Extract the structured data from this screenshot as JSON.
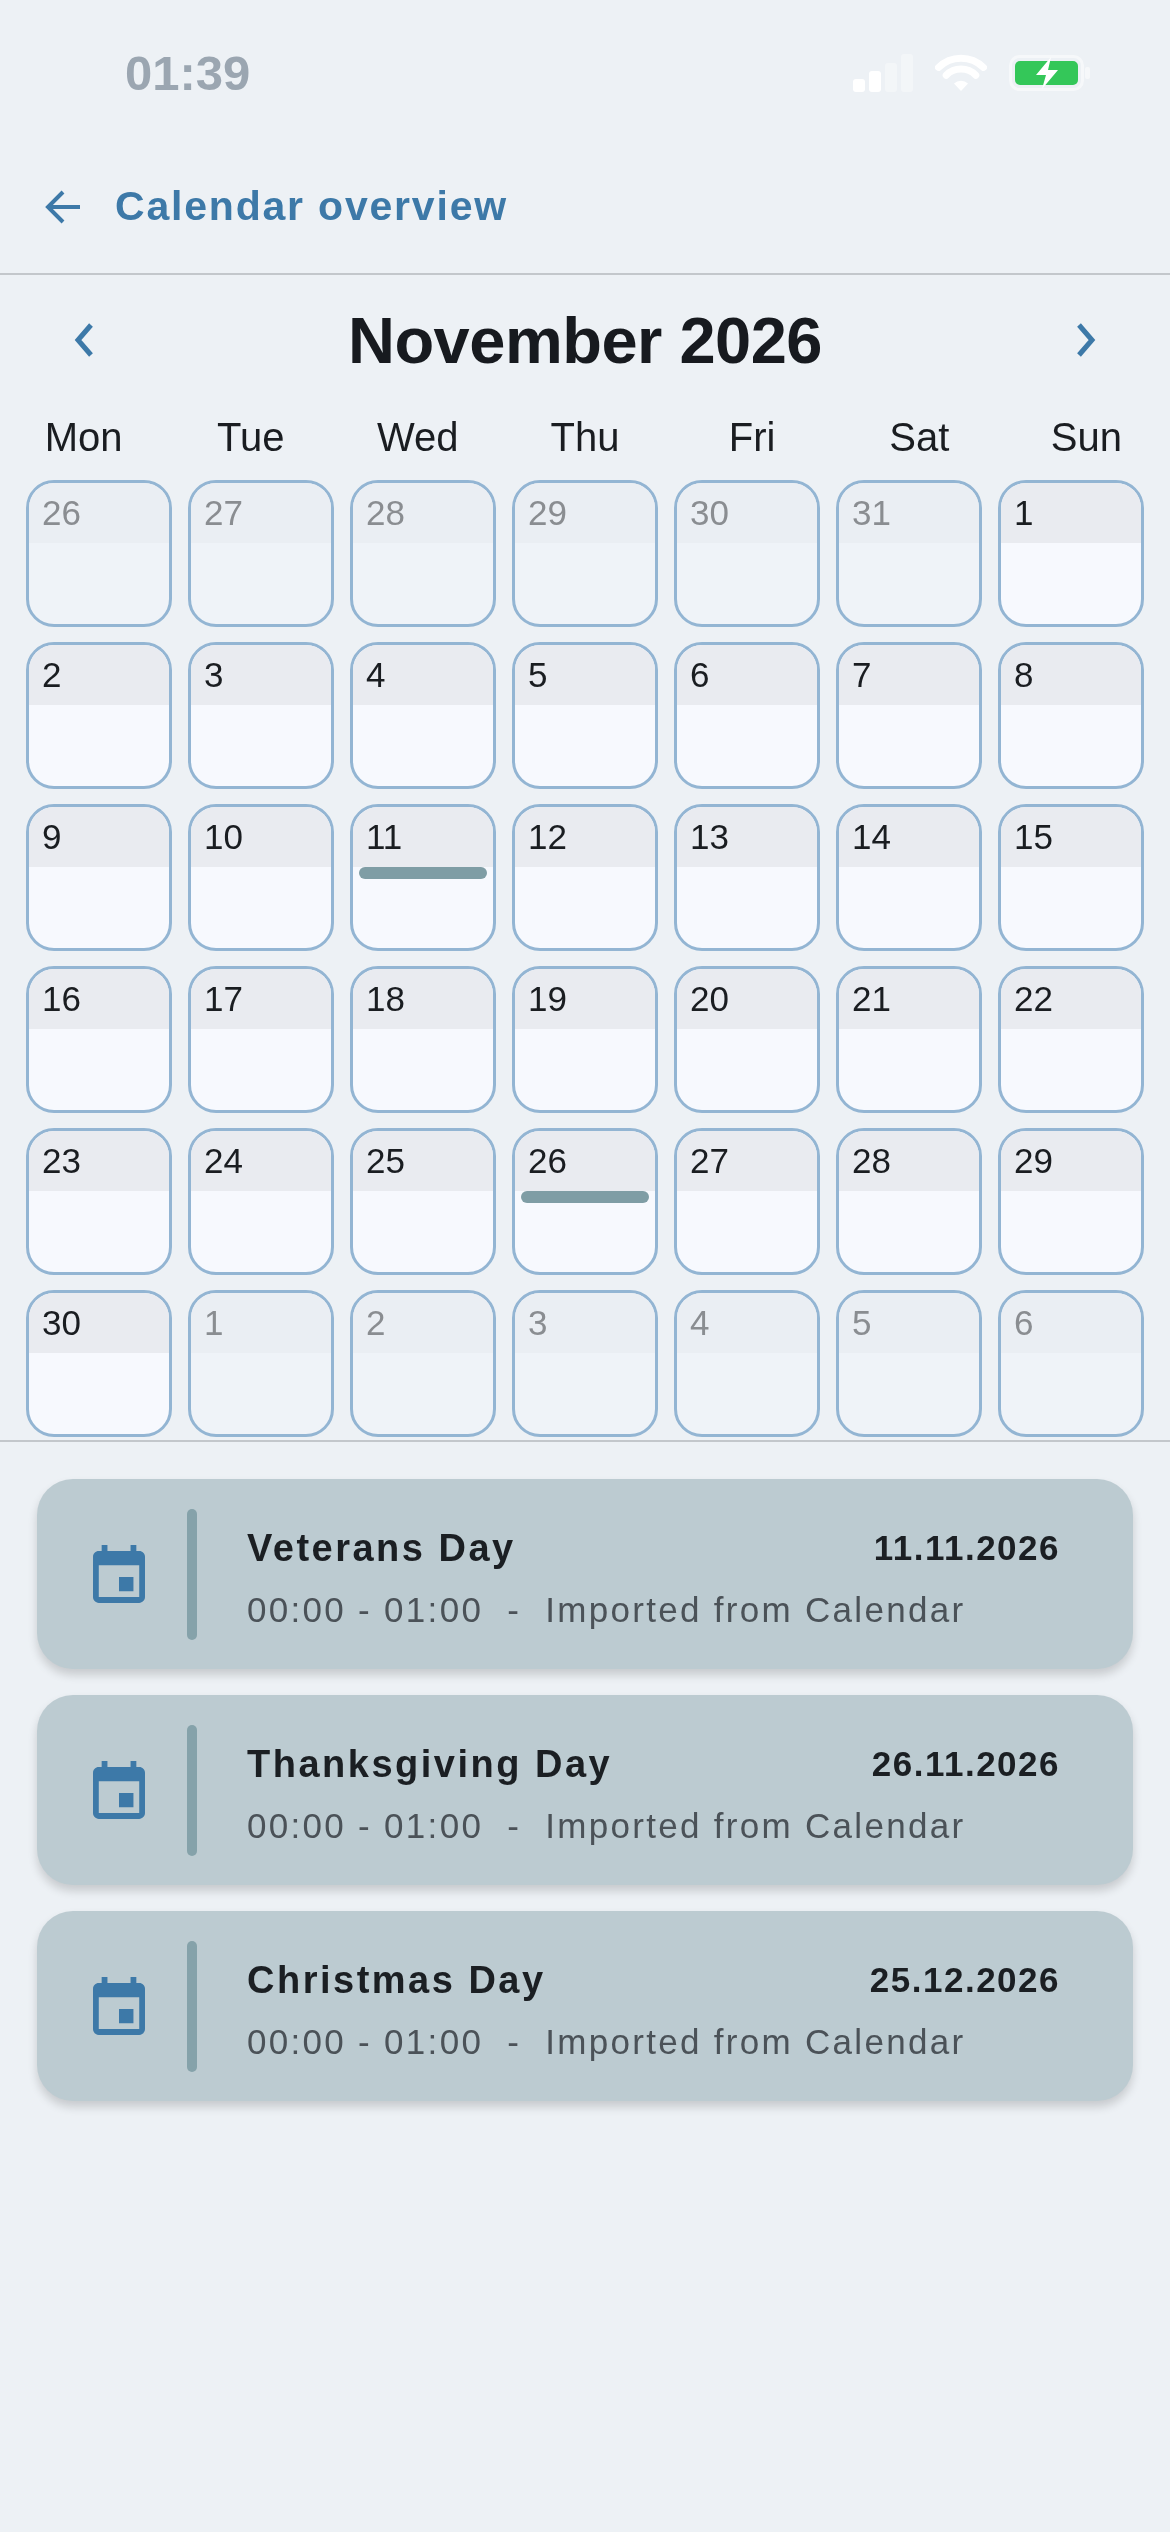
{
  "status_bar": {
    "time": "01:39"
  },
  "header": {
    "title": "Calendar overview"
  },
  "month_nav": {
    "title": "November 2026"
  },
  "weekdays": [
    "Mon",
    "Tue",
    "Wed",
    "Thu",
    "Fri",
    "Sat",
    "Sun"
  ],
  "days": [
    {
      "day": "26",
      "in_month": false,
      "event": false
    },
    {
      "day": "27",
      "in_month": false,
      "event": false
    },
    {
      "day": "28",
      "in_month": false,
      "event": false
    },
    {
      "day": "29",
      "in_month": false,
      "event": false
    },
    {
      "day": "30",
      "in_month": false,
      "event": false
    },
    {
      "day": "31",
      "in_month": false,
      "event": false
    },
    {
      "day": "1",
      "in_month": true,
      "event": false
    },
    {
      "day": "2",
      "in_month": true,
      "event": false
    },
    {
      "day": "3",
      "in_month": true,
      "event": false
    },
    {
      "day": "4",
      "in_month": true,
      "event": false
    },
    {
      "day": "5",
      "in_month": true,
      "event": false
    },
    {
      "day": "6",
      "in_month": true,
      "event": false
    },
    {
      "day": "7",
      "in_month": true,
      "event": false
    },
    {
      "day": "8",
      "in_month": true,
      "event": false
    },
    {
      "day": "9",
      "in_month": true,
      "event": false
    },
    {
      "day": "10",
      "in_month": true,
      "event": false
    },
    {
      "day": "11",
      "in_month": true,
      "event": true
    },
    {
      "day": "12",
      "in_month": true,
      "event": false
    },
    {
      "day": "13",
      "in_month": true,
      "event": false
    },
    {
      "day": "14",
      "in_month": true,
      "event": false
    },
    {
      "day": "15",
      "in_month": true,
      "event": false
    },
    {
      "day": "16",
      "in_month": true,
      "event": false
    },
    {
      "day": "17",
      "in_month": true,
      "event": false
    },
    {
      "day": "18",
      "in_month": true,
      "event": false
    },
    {
      "day": "19",
      "in_month": true,
      "event": false
    },
    {
      "day": "20",
      "in_month": true,
      "event": false
    },
    {
      "day": "21",
      "in_month": true,
      "event": false
    },
    {
      "day": "22",
      "in_month": true,
      "event": false
    },
    {
      "day": "23",
      "in_month": true,
      "event": false
    },
    {
      "day": "24",
      "in_month": true,
      "event": false
    },
    {
      "day": "25",
      "in_month": true,
      "event": false
    },
    {
      "day": "26",
      "in_month": true,
      "event": true
    },
    {
      "day": "27",
      "in_month": true,
      "event": false
    },
    {
      "day": "28",
      "in_month": true,
      "event": false
    },
    {
      "day": "29",
      "in_month": true,
      "event": false
    },
    {
      "day": "30",
      "in_month": true,
      "event": false
    },
    {
      "day": "1",
      "in_month": false,
      "event": false
    },
    {
      "day": "2",
      "in_month": false,
      "event": false
    },
    {
      "day": "3",
      "in_month": false,
      "event": false
    },
    {
      "day": "4",
      "in_month": false,
      "event": false
    },
    {
      "day": "5",
      "in_month": false,
      "event": false
    },
    {
      "day": "6",
      "in_month": false,
      "event": false
    }
  ],
  "events": [
    {
      "title": "Veterans Day",
      "date": "11.11.2026",
      "details": "00:00 - 01:00  -  Imported from Calendar"
    },
    {
      "title": "Thanksgiving Day",
      "date": "26.11.2026",
      "details": "00:00 - 01:00  -  Imported from Calendar"
    },
    {
      "title": "Christmas Day",
      "date": "25.12.2026",
      "details": "00:00 - 01:00  -  Imported from Calendar"
    }
  ]
}
